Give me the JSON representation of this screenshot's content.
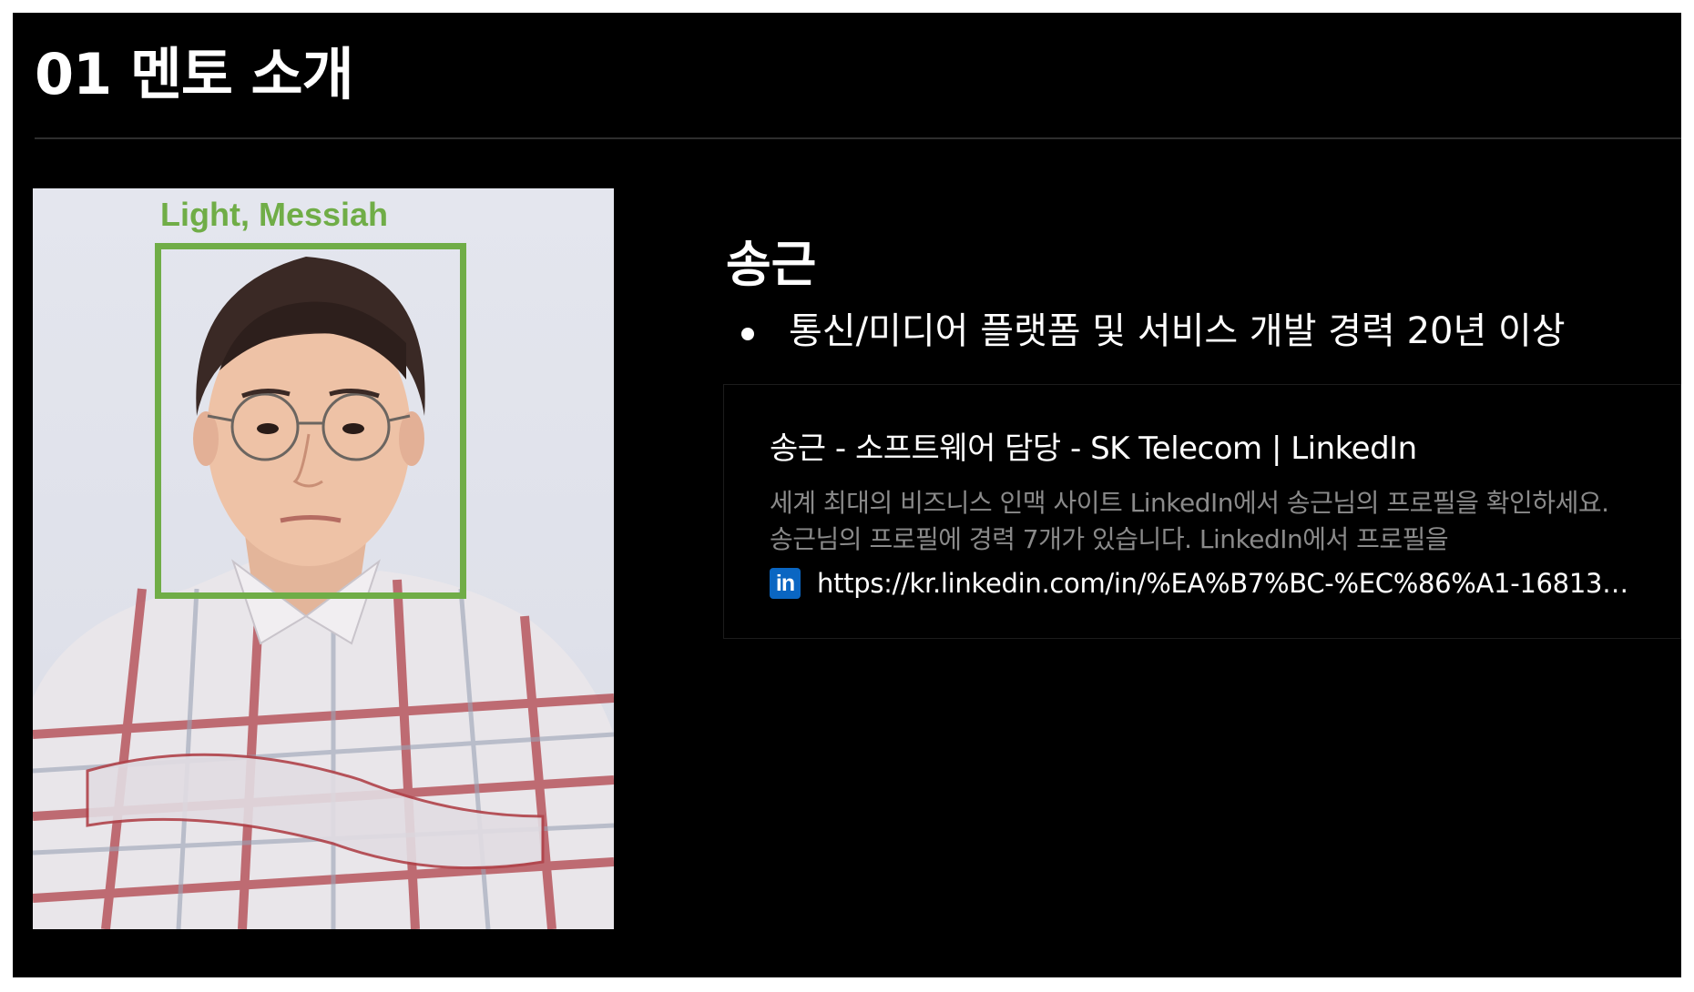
{
  "slide": {
    "title": "01 멘토 소개"
  },
  "photo": {
    "face_label": "Light, Messiah",
    "box_color": "#70ad47"
  },
  "mentor": {
    "name": "송근",
    "bullets": [
      "통신/미디어 플랫폼 및 서비스 개발 경력 20년 이상"
    ]
  },
  "link_card": {
    "title": "송근 - 소프트웨어 담당 - SK Telecom | LinkedIn",
    "description": "세계 최대의 비즈니스 인맥 사이트 LinkedIn에서 송근님의 프로필을 확인하세요. 송근님의 프로필에 경력 7개가 있습니다. LinkedIn에서 프로필을",
    "icon": "linkedin-icon",
    "icon_text": "in",
    "url": "https://kr.linkedin.com/in/%EA%B7%BC-%EC%86%A1-16813…",
    "brand_color": "#0a66c2"
  }
}
